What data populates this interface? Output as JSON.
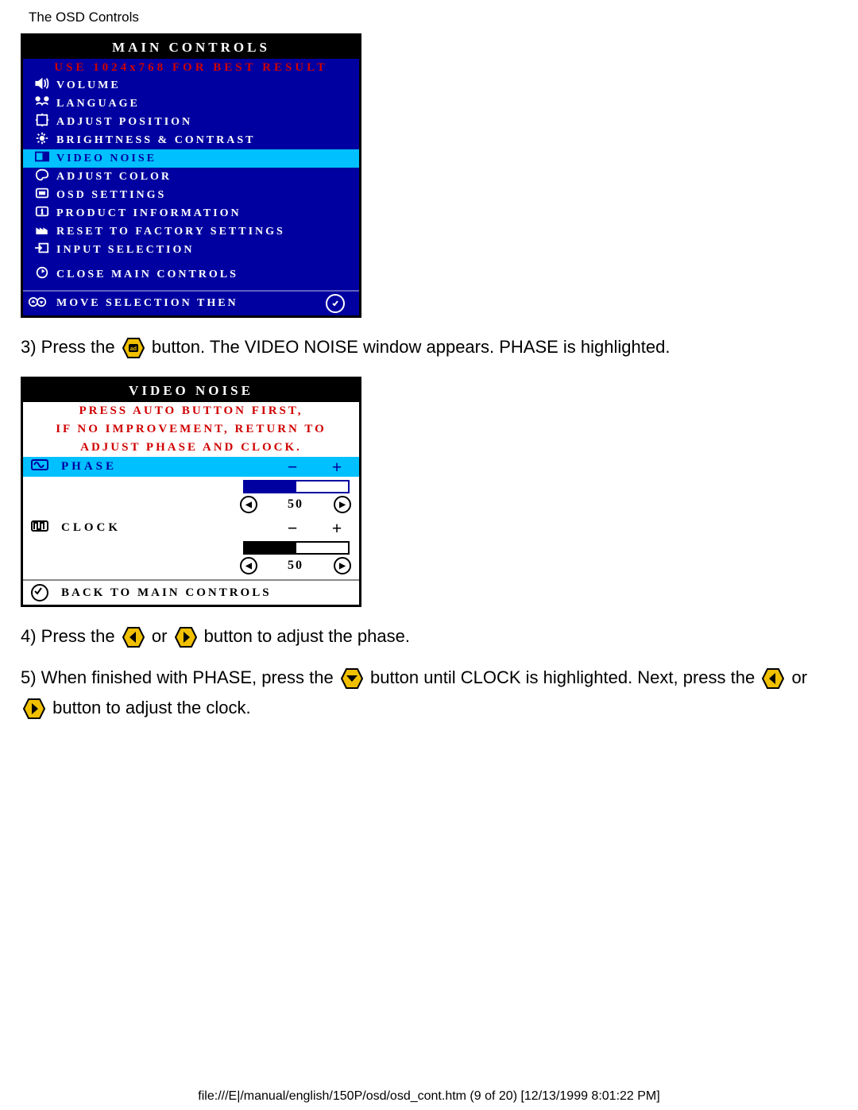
{
  "page_header": "The OSD Controls",
  "main_controls": {
    "title": "MAIN CONTROLS",
    "subtitle": "USE 1024x768 FOR BEST RESULT",
    "items": [
      {
        "label": "VOLUME",
        "selected": false
      },
      {
        "label": "LANGUAGE",
        "selected": false
      },
      {
        "label": "ADJUST POSITION",
        "selected": false
      },
      {
        "label": "BRIGHTNESS & CONTRAST",
        "selected": false
      },
      {
        "label": "VIDEO NOISE",
        "selected": true
      },
      {
        "label": "ADJUST COLOR",
        "selected": false
      },
      {
        "label": "OSD SETTINGS",
        "selected": false
      },
      {
        "label": "PRODUCT INFORMATION",
        "selected": false
      },
      {
        "label": "RESET TO FACTORY SETTINGS",
        "selected": false
      },
      {
        "label": "INPUT SELECTION",
        "selected": false
      }
    ],
    "close": "CLOSE MAIN CONTROLS",
    "footer": "MOVE SELECTION THEN"
  },
  "step3": {
    "a": "3) Press the ",
    "b": " button. The VIDEO NOISE window appears. PHASE is highlighted."
  },
  "video_noise": {
    "title": "VIDEO NOISE",
    "hint1": "PRESS AUTO BUTTON FIRST,",
    "hint2": "IF NO IMPROVEMENT, RETURN TO",
    "hint3": "ADJUST PHASE AND CLOCK.",
    "rows": [
      {
        "name": "PHASE",
        "value": 50,
        "minus": "−",
        "plus": "+",
        "selected": true
      },
      {
        "name": "CLOCK",
        "value": 50,
        "minus": "−",
        "plus": "+",
        "selected": false
      }
    ],
    "back": "BACK TO MAIN CONTROLS"
  },
  "step4": {
    "a": "4) Press the ",
    "b": " or ",
    "c": " button to adjust the phase."
  },
  "step5": {
    "a": "5) When finished with PHASE, press the ",
    "b": " button until CLOCK is highlighted. Next, press the ",
    "c": " or"
  },
  "step5b": " button to adjust the clock.",
  "footer": "file:///E|/manual/english/150P/osd/osd_cont.htm (9 of 20) [12/13/1999 8:01:22 PM]"
}
